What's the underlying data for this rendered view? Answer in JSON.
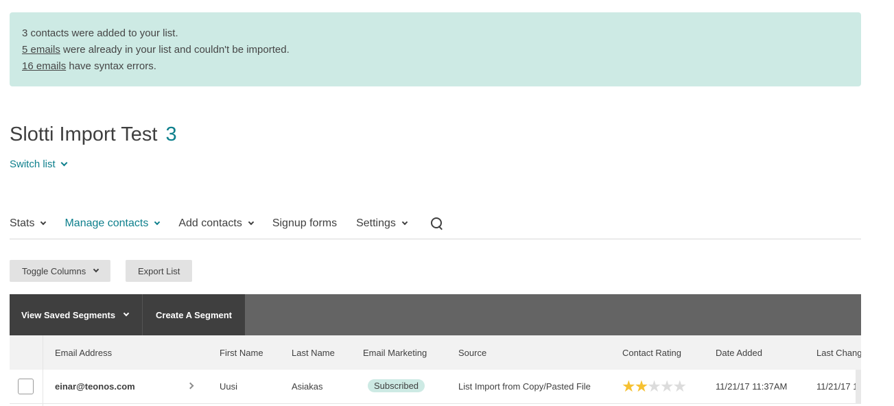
{
  "notice": {
    "line1": "3 contacts were added to your list.",
    "line2_link": "5 emails",
    "line2_text": " were already in your list and couldn't be imported.",
    "line3_link": "16 emails",
    "line3_text": " have syntax errors."
  },
  "list": {
    "title": "Slotti Import Test",
    "count": "3",
    "switch_label": "Switch list"
  },
  "tabs": [
    {
      "label": "Stats"
    },
    {
      "label": "Manage contacts"
    },
    {
      "label": "Add contacts"
    },
    {
      "label": "Signup forms"
    },
    {
      "label": "Settings"
    }
  ],
  "toolbar": {
    "toggle_columns": "Toggle Columns",
    "export_list": "Export List"
  },
  "segments": {
    "view_saved": "View Saved Segments",
    "create": "Create A Segment"
  },
  "table": {
    "columns": [
      "Email Address",
      "First Name",
      "Last Name",
      "Email Marketing",
      "Source",
      "Contact Rating",
      "Date Added",
      "Last Chang"
    ],
    "rows": [
      {
        "email": "einar@teonos.com",
        "first_name": "Uusi",
        "last_name": "Asiakas",
        "email_marketing": "Subscribed",
        "source": "List Import from Copy/Pasted File",
        "rating": 2,
        "rating_max": 5,
        "date_added": "11/21/17 11:37AM",
        "last_changed": "11/21/17 1"
      }
    ]
  },
  "colors": {
    "accent": "#0d7f8c",
    "notice_bg": "#cdeae4",
    "star_on": "#f6c132",
    "star_off": "#dcdcdc"
  }
}
